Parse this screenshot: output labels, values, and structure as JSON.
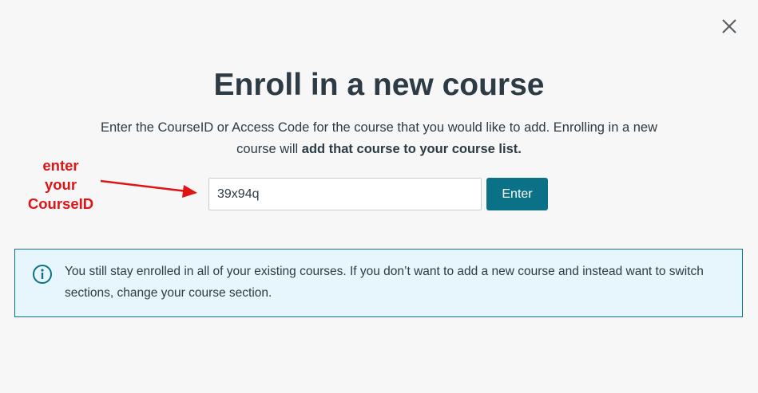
{
  "dialog": {
    "close_label": "close",
    "title": "Enroll in a new course",
    "description_plain": "Enter the CourseID or Access Code for the course that you would like to add. Enrolling in a new course will ",
    "description_bold": "add that course to your course list.",
    "course_input": {
      "value": "39x94q"
    },
    "enter_label": "Enter",
    "info_text": "You still stay enrolled in all of your existing courses. If you don’t want to add a new course and instead want to switch sections, change your course section."
  },
  "annotation": {
    "lines": [
      "enter",
      "your",
      "CourseID"
    ],
    "color": "#e01414"
  },
  "colors": {
    "accent": "#0b7186",
    "info_background": "#e7f5fc",
    "page_background": "#f7f7f7",
    "text": "#2d3b45"
  },
  "icons": {
    "close": "close-icon",
    "info": "info-icon",
    "arrow": "arrow-icon"
  }
}
